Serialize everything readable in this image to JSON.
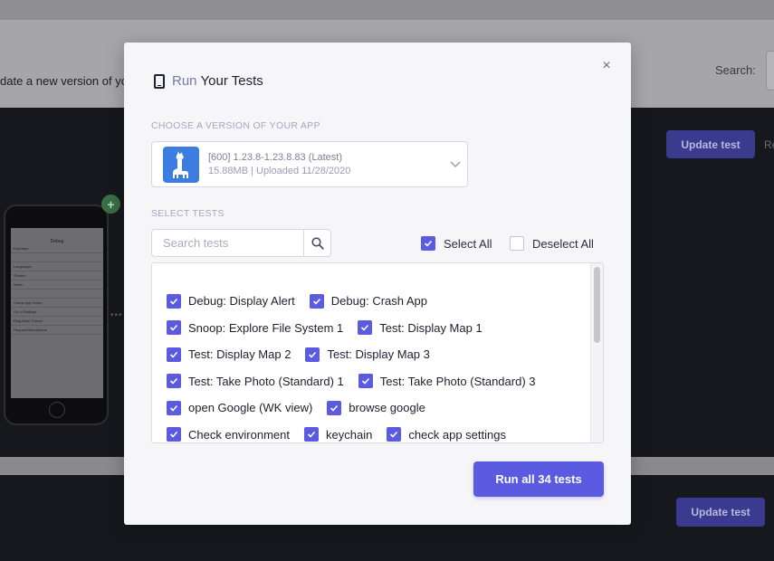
{
  "background": {
    "header_text": "date a new version of yo",
    "search_label": "Search:",
    "update_button_label": "Update test",
    "update_button_label_bottom": "Update test",
    "partial_text": "Re",
    "plus_badge": "+",
    "phone_screen": {
      "title": "Debug",
      "rows": [
        "Keychain",
        "",
        "Languages",
        "Shakes",
        "When",
        "",
        "Check App Group",
        "Go to Settings",
        "Ring Main Thread",
        "Request Microphone"
      ]
    }
  },
  "modal": {
    "title_prefix": "Run",
    "title_rest": "Your Tests",
    "close_label": "×",
    "version_section_label": "CHOOSE A VERSION OF YOUR APP",
    "version": {
      "name": "[600] 1.23.8-1.23.8.83 (Latest)",
      "meta": "15.88MB | Uploaded 11/28/2020"
    },
    "tests_section_label": "SELECT TESTS",
    "search_placeholder": "Search tests",
    "select_all_label": "Select All",
    "deselect_all_label": "Deselect All",
    "select_all_checked": true,
    "deselect_all_checked": false,
    "tests": [
      [
        "Debug: Display Alert",
        "Debug: Crash App"
      ],
      [
        "Snoop: Explore File System 1",
        "Test: Display Map 1"
      ],
      [
        "Test: Display Map 2",
        "Test: Display Map 3"
      ],
      [
        "Test: Take Photo (Standard) 1",
        "Test: Take Photo (Standard) 3"
      ],
      [
        "open Google (WK view)",
        "browse google"
      ],
      [
        "Check environment",
        "keychain",
        "check app settings"
      ]
    ],
    "run_button_label": "Run all 34 tests"
  },
  "colors": {
    "accent": "#5a5be0",
    "app_icon": "#3e7de0"
  }
}
